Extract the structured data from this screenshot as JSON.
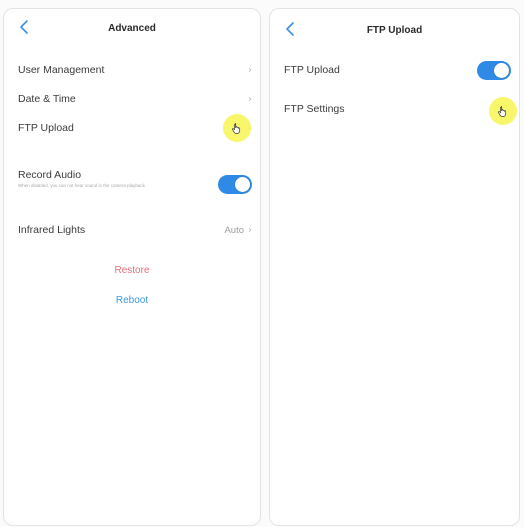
{
  "left_screen": {
    "title": "Advanced",
    "items": [
      {
        "label": "User Management",
        "chevron": "›"
      },
      {
        "label": "Date & Time",
        "chevron": "›"
      },
      {
        "label": "FTP Upload",
        "chevron": "›"
      }
    ],
    "record_audio": {
      "label": "Record Audio",
      "subtext": "When disabled, you can not hear sound in the camera playback.",
      "enabled": true
    },
    "infrared": {
      "label": "Infrared Lights",
      "value": "Auto",
      "chevron": "›"
    },
    "restore_label": "Restore",
    "reboot_label": "Reboot"
  },
  "right_screen": {
    "title": "FTP Upload",
    "ftp_upload": {
      "label": "FTP Upload",
      "enabled": true
    },
    "ftp_settings": {
      "label": "FTP Settings"
    }
  },
  "icons": {
    "back": "back-chevron-icon",
    "cursor": "hand-pointer-icon"
  },
  "colors": {
    "toggle_on": "#2f8ae6",
    "restore": "#e36f7b",
    "reboot": "#3e9be0",
    "highlight": "#f7f550"
  }
}
